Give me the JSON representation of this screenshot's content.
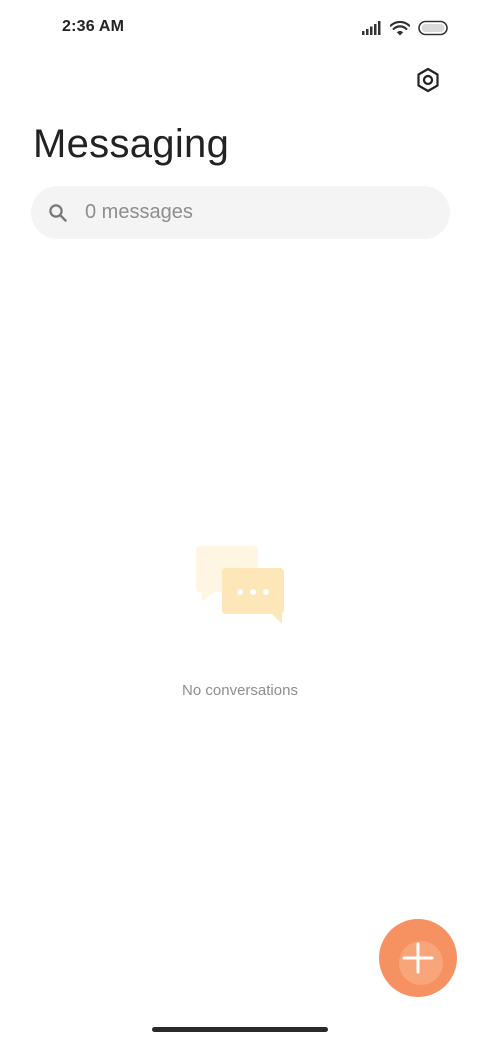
{
  "status_bar": {
    "time": "2:36 AM"
  },
  "header": {
    "title": "Messaging"
  },
  "search": {
    "placeholder": "0 messages"
  },
  "empty_state": {
    "text": "No conversations"
  },
  "icons": {
    "settings": "settings-hexagon-icon",
    "search": "search-icon",
    "empty": "chat-bubbles-icon",
    "compose": "plus-icon"
  },
  "colors": {
    "accent": "#f69262",
    "empty_illustration": "#fde7b8",
    "text_primary": "#222222",
    "text_secondary": "#8e8e8e",
    "search_background": "#f4f4f4"
  }
}
